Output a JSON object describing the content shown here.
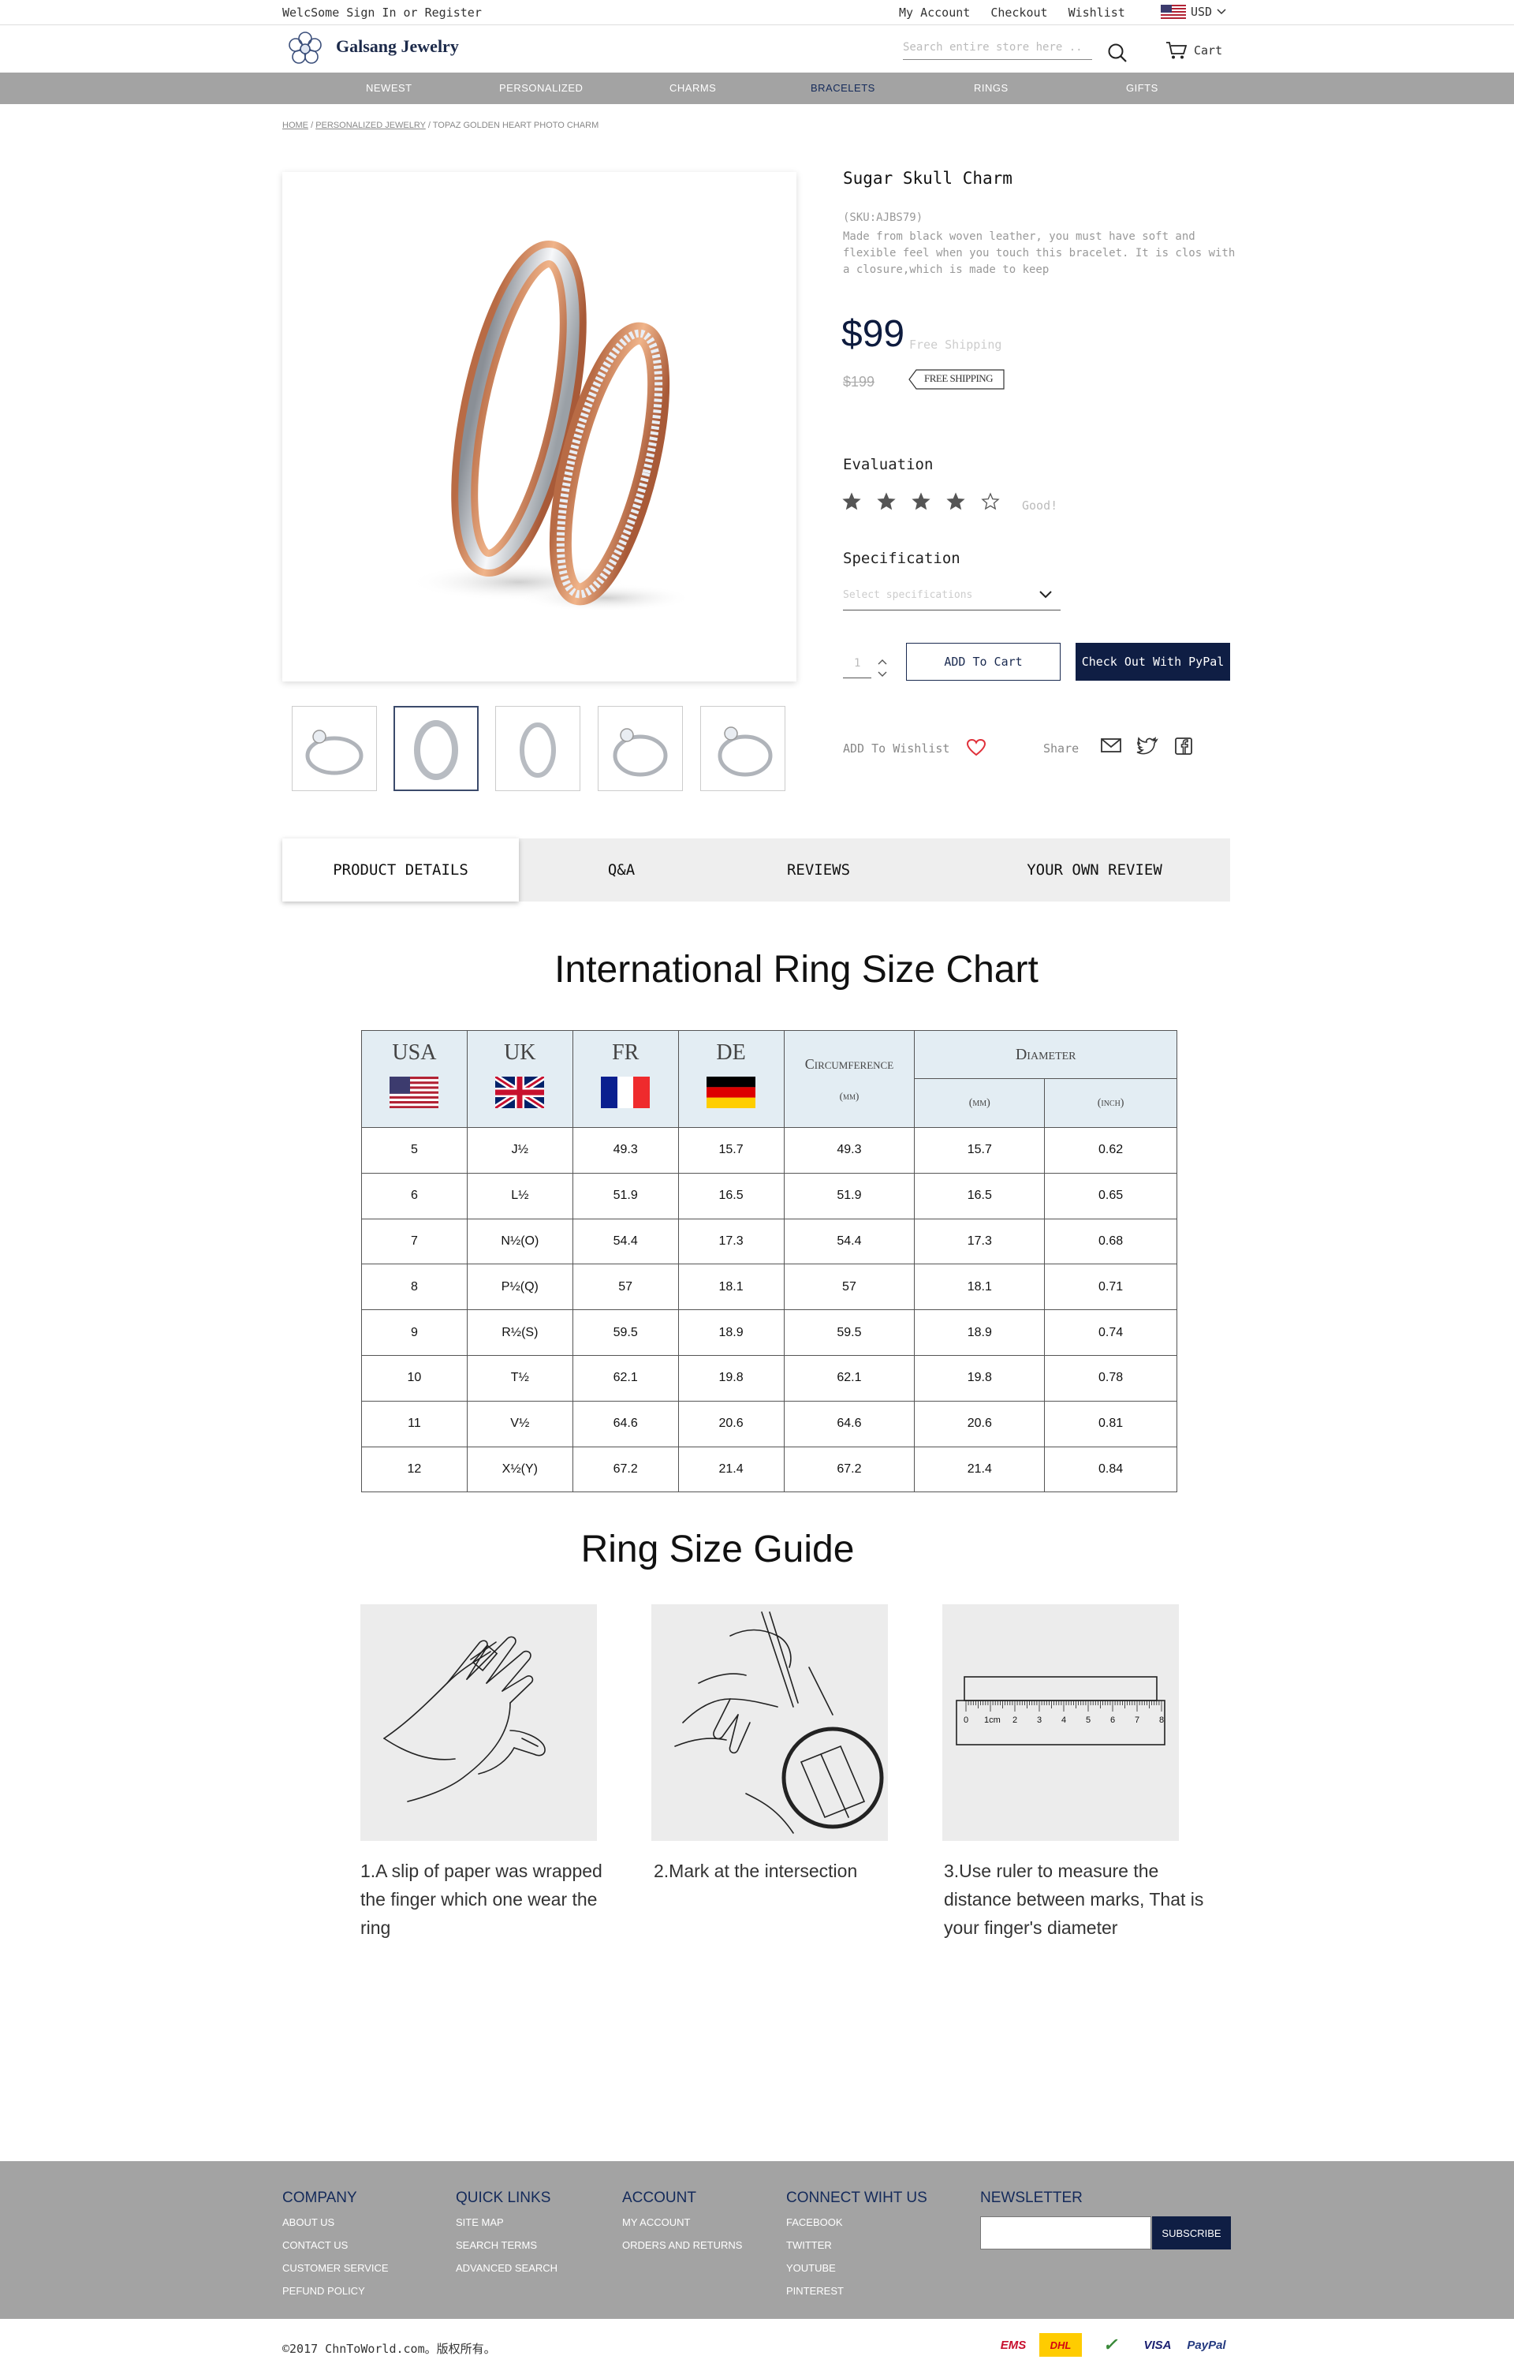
{
  "topbar": {
    "welcome": "WelcSome Sign In or Register",
    "links": [
      "My Account",
      "Checkout",
      "Wishlist"
    ],
    "currency": "USD"
  },
  "header": {
    "brand": "Galsang Jewelry",
    "search_placeholder": "Search entire store here ..",
    "cart_label": "Cart"
  },
  "nav": {
    "items": [
      "NEWEST",
      "PERSONALIZED",
      "CHARMS",
      "BRACELETS",
      "RINGS",
      "GIFTS"
    ],
    "active": "BRACELETS",
    "active_color": "#142a5a"
  },
  "breadcrumb": {
    "home": "HOME",
    "category": "PERSONALIZED JEWELRY",
    "current": "TOPAZ GOLDEN HEART PHOTO CHARM",
    "separator": "/"
  },
  "product": {
    "title": "Sugar Skull Charm",
    "sku": "(SKU:AJBS79)",
    "description": "Made from black woven leather, you must have soft and flexible feel when you touch this bracelet. It is clos with a closure,which is made to keep",
    "price": "$99",
    "free_shipping_note": "Free Shipping",
    "old_price": "$199",
    "badge": "FREE SHIPPING",
    "evaluation_label": "Evaluation",
    "rating": 4,
    "rating_max": 5,
    "rating_text": "Good!",
    "spec_label": "Specification",
    "spec_placeholder": "Select specifications",
    "quantity": "1",
    "add_to_cart": "ADD To Cart",
    "checkout_paypal": "Check Out With PyPal",
    "wishlist_label": "ADD To Wishlist",
    "share_label": "Share",
    "thumbnails": [
      "ring-solitaire",
      "ring-band",
      "ring-band-thin",
      "ring-solitaire-2",
      "ring-solitaire-3"
    ],
    "active_thumbnail": 1
  },
  "tabs": {
    "items": [
      "PRODUCT DETAILS",
      "Q&A",
      "REVIEWS",
      "YOUR OWN REVIEW"
    ],
    "active": 0
  },
  "size_chart": {
    "title": "International Ring Size Chart",
    "headers": [
      "USA",
      "UK",
      "FR",
      "DE"
    ],
    "circumference": "Circumference",
    "circumference_unit": "(mm)",
    "diameter": "Diameter",
    "diameter_mm": "(mm)",
    "diameter_inch": "(inch)",
    "rows": [
      [
        "5",
        "J½",
        "49.3",
        "15.7",
        "49.3",
        "15.7",
        "0.62"
      ],
      [
        "6",
        "L½",
        "51.9",
        "16.5",
        "51.9",
        "16.5",
        "0.65"
      ],
      [
        "7",
        "N½(O)",
        "54.4",
        "17.3",
        "54.4",
        "17.3",
        "0.68"
      ],
      [
        "8",
        "P½(Q)",
        "57",
        "18.1",
        "57",
        "18.1",
        "0.71"
      ],
      [
        "9",
        "R½(S)",
        "59.5",
        "18.9",
        "59.5",
        "18.9",
        "0.74"
      ],
      [
        "10",
        "T½",
        "62.1",
        "19.8",
        "62.1",
        "19.8",
        "0.78"
      ],
      [
        "11",
        "V½",
        "64.6",
        "20.6",
        "64.6",
        "20.6",
        "0.81"
      ],
      [
        "12",
        "X½(Y)",
        "67.2",
        "21.4",
        "67.2",
        "21.4",
        "0.84"
      ]
    ]
  },
  "guide": {
    "title": "Ring Size Guide",
    "steps": [
      "1.A slip of paper was wrapped the finger which one wear the ring",
      "2.Mark at the intersection",
      "3.Use ruler to measure the distance between marks, That is your finger's diameter"
    ],
    "ruler_marks": [
      "0",
      "1cm",
      "2",
      "3",
      "4",
      "5",
      "6",
      "7",
      "8"
    ]
  },
  "footer": {
    "columns": [
      {
        "title": "COMPANY",
        "links": [
          "ABOUT US",
          "CONTACT US",
          "CUSTOMER SERVICE",
          "PEFUND POLICY"
        ]
      },
      {
        "title": "QUICK LINKS",
        "links": [
          "SITE MAP",
          "SEARCH TERMS",
          "ADVANCED SEARCH"
        ]
      },
      {
        "title": "ACCOUNT",
        "links": [
          "MY ACCOUNT",
          "ORDERS AND RETURNS"
        ]
      },
      {
        "title": "CONNECT WIHT US",
        "links": [
          "FACEBOOK",
          "TWITTER",
          "YOUTUBE",
          "PINTEREST"
        ]
      }
    ],
    "newsletter_title": "NEWSLETTER",
    "subscribe": "SUBSCRIBE",
    "copyright": "©2017 ChnToWorld.com。版权所有。",
    "payments": [
      "EMS",
      "DHL",
      "✓",
      "VISA",
      "PayPal"
    ]
  },
  "colors": {
    "navy": "#0f1e44",
    "nav_gray": "#a3a3a3",
    "table_header": "#e3edf3",
    "heart": "#e0303a"
  }
}
